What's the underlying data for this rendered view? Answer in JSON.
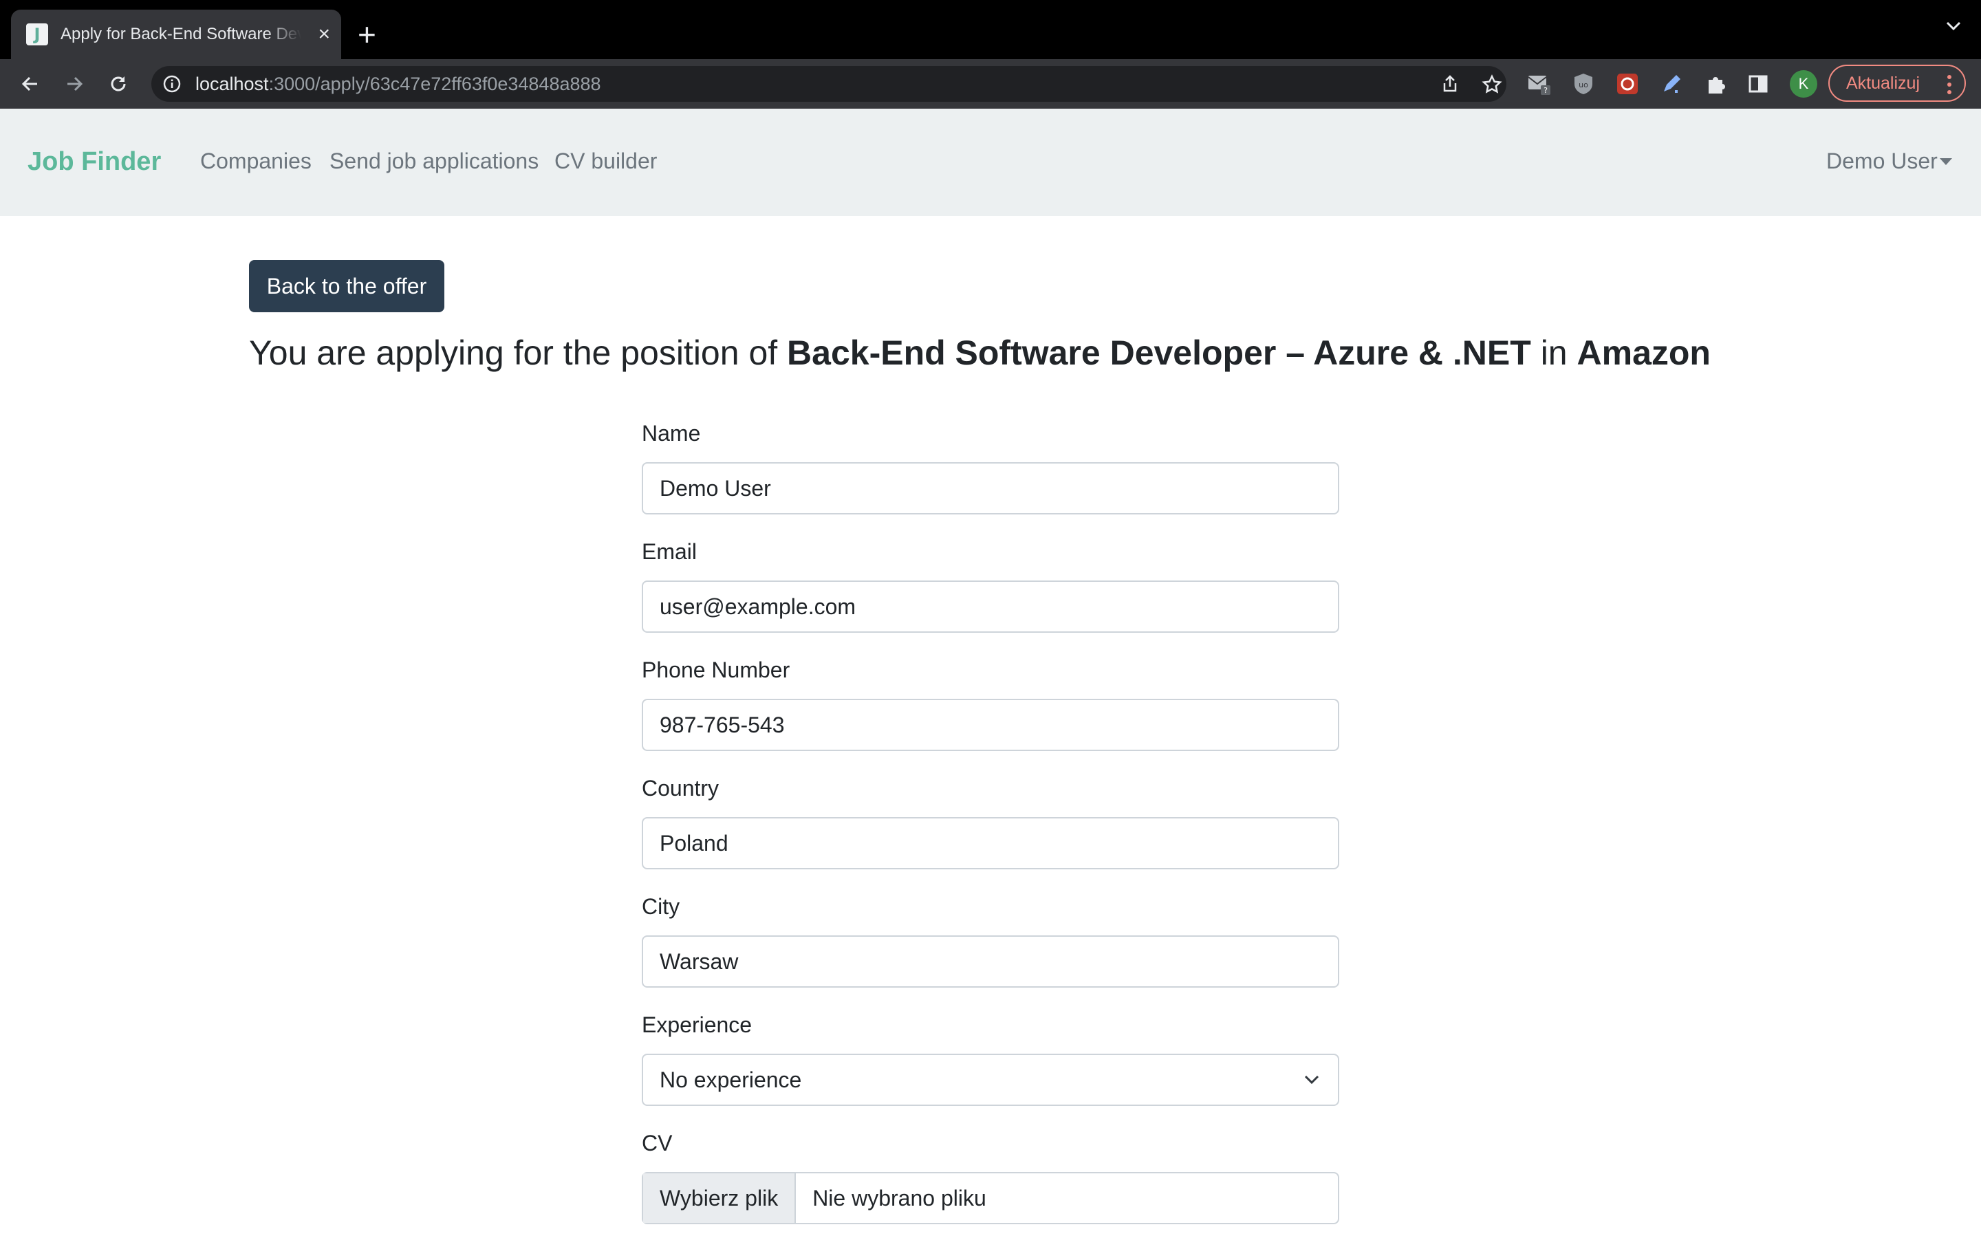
{
  "browser": {
    "tab_title": "Apply for Back-End Software Developer – Azure & .NET",
    "tab_favicon_letter": "J",
    "url_host": "localhost",
    "url_path": ":3000/apply/63c47e72ff63f0e34848a888",
    "profile_initial": "K",
    "update_label": "Aktualizuj"
  },
  "navbar": {
    "brand": "Job Finder",
    "links": [
      "Companies",
      "Send job applications",
      "CV builder"
    ],
    "user": "Demo User"
  },
  "page": {
    "back_label": "Back to the offer",
    "heading": {
      "prefix": "You are applying for the position of ",
      "position": "Back-End Software Developer – Azure & .NET",
      "middle": " in ",
      "company": "Amazon"
    }
  },
  "form": {
    "name_label": "Name",
    "name_value": "Demo User",
    "email_label": "Email",
    "email_value": "user@example.com",
    "phone_label": "Phone Number",
    "phone_value": "987-765-543",
    "country_label": "Country",
    "country_value": "Poland",
    "city_label": "City",
    "city_value": "Warsaw",
    "experience_label": "Experience",
    "experience_value": "No experience",
    "cv_label": "CV",
    "cv_button": "Wybierz plik",
    "cv_status": "Nie wybrano pliku"
  },
  "colors": {
    "brand": "#5cb89a",
    "navbar_bg": "#ecf0f1",
    "primary_button": "#2c3e50",
    "text": "#212529",
    "muted": "#6c757d"
  }
}
